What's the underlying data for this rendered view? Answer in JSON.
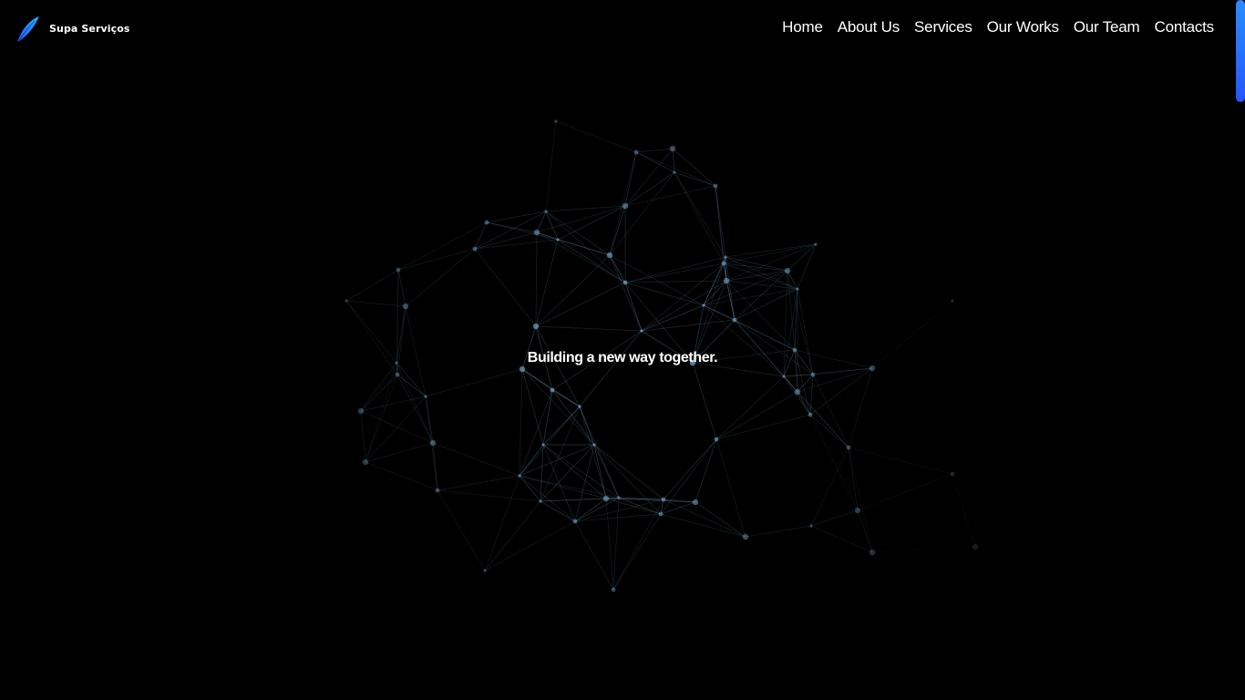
{
  "brand": {
    "name": "Supa Serviços",
    "logo_icon": "feather-swoosh-logo",
    "logo_colors": [
      "#1fb4ff",
      "#2450ff"
    ]
  },
  "nav": {
    "items": [
      {
        "label": "Home"
      },
      {
        "label": "About Us"
      },
      {
        "label": "Services"
      },
      {
        "label": "Our Works"
      },
      {
        "label": "Our Team"
      },
      {
        "label": "Contacts"
      }
    ]
  },
  "hero": {
    "tagline": "Building a new way together."
  },
  "theme": {
    "background": "#000000",
    "text": "#ffffff",
    "network_color": "#7fb4d6",
    "scroll_indicator": "#2a6bff"
  }
}
